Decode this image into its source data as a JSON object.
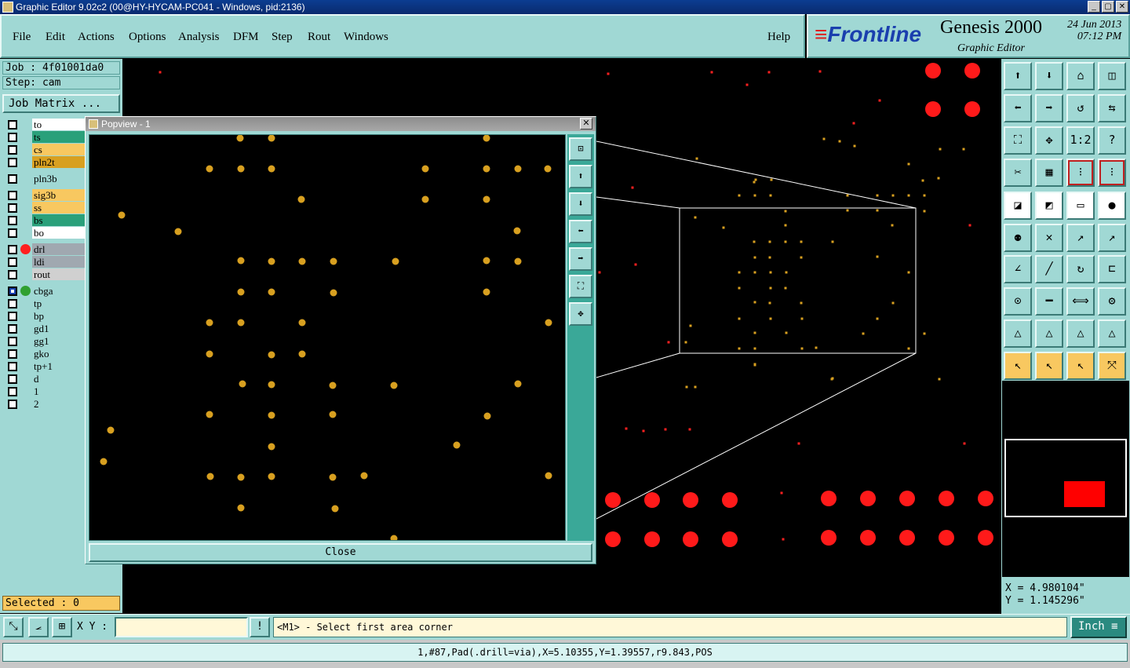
{
  "window": {
    "title": "Graphic Editor 9.02c2 (00@HY-HYCAM-PC041 - Windows, pid:2136)",
    "controls": [
      "_",
      "▢",
      "✕"
    ]
  },
  "menu": {
    "items": [
      "File",
      "Edit",
      "Actions",
      "Options",
      "Analysis",
      "DFM",
      "Step",
      "Rout",
      "Windows"
    ],
    "help": "Help"
  },
  "brand": {
    "logo": "Frontline",
    "product": "Genesis 2000",
    "subtitle": "Graphic Editor",
    "date": "24 Jun 2013",
    "time": "07:12 PM"
  },
  "job": {
    "job_label": "Job : 4f01001da0",
    "step_label": "Step: cam",
    "matrix_button": "Job Matrix ..."
  },
  "layers": [
    {
      "name": "to",
      "color": "#ffffff",
      "checked": false,
      "dot": ""
    },
    {
      "name": "ts",
      "color": "#2aa07a",
      "checked": false,
      "dot": ""
    },
    {
      "name": "cs",
      "color": "#f8c860",
      "checked": false,
      "dot": ""
    },
    {
      "name": "pln2t",
      "color": "#d8a020",
      "checked": false,
      "dot": ""
    },
    {
      "name": "pln3b",
      "color": "#a0d8d4",
      "checked": false,
      "dot": ""
    },
    {
      "name": "sig3b",
      "color": "#f8c860",
      "checked": false,
      "dot": ""
    },
    {
      "name": "ss",
      "color": "#f8c860",
      "checked": false,
      "dot": ""
    },
    {
      "name": "bs",
      "color": "#2aa07a",
      "checked": false,
      "dot": ""
    },
    {
      "name": "bo",
      "color": "#ffffff",
      "checked": false,
      "dot": ""
    },
    {
      "name": "drl",
      "color": "#a0a8b0",
      "checked": false,
      "dot": "#ff2020"
    },
    {
      "name": "ldi",
      "color": "#a0a8b0",
      "checked": false,
      "dot": ""
    },
    {
      "name": "rout",
      "color": "#d0d0d0",
      "checked": false,
      "dot": ""
    },
    {
      "name": "cbga",
      "color": "#a0d8d4",
      "checked": true,
      "dot": "#30a030"
    },
    {
      "name": "tp",
      "color": "#a0d8d4",
      "checked": false,
      "dot": ""
    },
    {
      "name": "bp",
      "color": "#a0d8d4",
      "checked": false,
      "dot": ""
    },
    {
      "name": "gd1",
      "color": "#a0d8d4",
      "checked": false,
      "dot": ""
    },
    {
      "name": "gg1",
      "color": "#a0d8d4",
      "checked": false,
      "dot": ""
    },
    {
      "name": "gko",
      "color": "#a0d8d4",
      "checked": false,
      "dot": ""
    },
    {
      "name": "tp+1",
      "color": "#a0d8d4",
      "checked": false,
      "dot": ""
    },
    {
      "name": "d",
      "color": "#a0d8d4",
      "checked": false,
      "dot": ""
    },
    {
      "name": "1",
      "color": "#a0d8d4",
      "checked": false,
      "dot": ""
    },
    {
      "name": "2",
      "color": "#a0d8d4",
      "checked": false,
      "dot": ""
    }
  ],
  "selected": "Selected : 0",
  "popview": {
    "title": "Popview - 1",
    "close_label": "Close"
  },
  "bottom": {
    "xy_label": "X Y :",
    "xy_value": "",
    "prompt": "<M1> - Select first area corner",
    "unit": "Inch",
    "status_line": "1,#87,Pad(.drill=via),X=5.10355,Y=1.39557,r9.843,POS"
  },
  "coords": {
    "x": "X = 4.980104\"",
    "y": "Y = 1.145296\""
  },
  "colors": {
    "panel": "#a0d8d4",
    "pad_gold": "#d8a020",
    "pad_red": "#ff1a1a"
  }
}
